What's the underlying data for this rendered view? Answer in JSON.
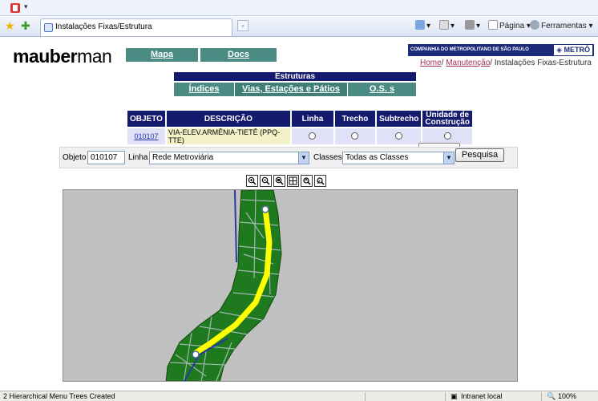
{
  "browser": {
    "tab_title": "Instalações Fixas/Estrutura",
    "commands": {
      "page": "Página",
      "tools": "Ferramentas"
    }
  },
  "page": {
    "logo_bold": "mauber",
    "logo_light": "man",
    "nav": {
      "mapa": "Mapa",
      "docs": "Docs"
    },
    "company": "COMPANHIA DO METROPOLITANO DE SÃO PAULO",
    "metro_badge": "METRÔ",
    "breadcrumb": {
      "home": "Home",
      "maintenance": "Manutenção",
      "current": "Instalações Fixas-Estrutura"
    },
    "section_title": "Estruturas",
    "subtabs": [
      "Índices",
      "Vias, Estações e Pátios",
      "O.S. s"
    ]
  },
  "grid": {
    "headers": [
      "OBJETO",
      "DESCRIÇÃO",
      "Linha",
      "Trecho",
      "Subtrecho",
      "Unidade de Construção"
    ],
    "row": {
      "objeto": "010107",
      "descricao": "VIA-ELEV.ARMÊNIA-TIETÊ (PPQ-TTE)"
    }
  },
  "filter": {
    "objeto_label": "Objeto",
    "objeto_value": "010107",
    "linha_label": "Linha",
    "linha_value": "Rede Metroviária",
    "classes_label": "Classes",
    "classes_value": "Todas as Classes",
    "search_button": "Pesquisa"
  },
  "map": {
    "background": "#c0c0c0",
    "land_color": "#1f7a1f",
    "route_color": "#ffff00",
    "water_color": "#2a3a9a",
    "tools": [
      "zoom-in-icon",
      "zoom-out-icon",
      "zoom-window-icon",
      "pan-icon",
      "refresh-icon",
      "select-icon"
    ]
  },
  "statusbar": {
    "message": "2 Hierarchical Menu Trees Created",
    "zone": "Intranet local",
    "zoom": "100%"
  }
}
